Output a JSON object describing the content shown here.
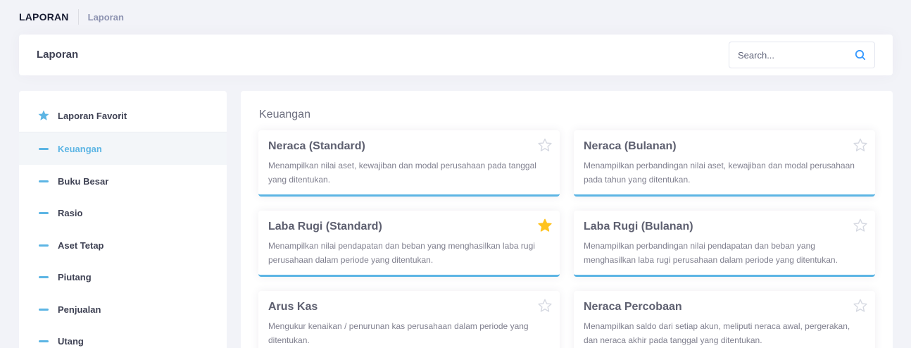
{
  "subheader": {
    "title": "LAPORAN",
    "breadcrumb": "Laporan"
  },
  "topbar": {
    "heading": "Laporan",
    "search_placeholder": "Search..."
  },
  "sidebar": {
    "favorite_label": "Laporan Favorit",
    "items": [
      {
        "label": "Keuangan",
        "active": true
      },
      {
        "label": "Buku Besar"
      },
      {
        "label": "Rasio"
      },
      {
        "label": "Aset Tetap"
      },
      {
        "label": "Piutang"
      },
      {
        "label": "Penjualan"
      },
      {
        "label": "Utang"
      }
    ]
  },
  "main": {
    "section_title": "Keuangan",
    "cards": [
      {
        "title": "Neraca (Standard)",
        "desc": "Menampilkan nilai aset, kewajiban dan modal perusahaan pada tanggal yang ditentukan.",
        "favorite": false
      },
      {
        "title": "Neraca (Bulanan)",
        "desc": "Menampilkan perbandingan nilai aset, kewajiban dan modal perusahaan pada tahun yang ditentukan.",
        "favorite": false
      },
      {
        "title": "Laba Rugi (Standard)",
        "desc": "Menampilkan nilai pendapatan dan beban yang menghasilkan laba rugi perusahaan dalam periode yang ditentukan.",
        "favorite": true
      },
      {
        "title": "Laba Rugi (Bulanan)",
        "desc": "Menampilkan perbandingan nilai pendapatan dan beban yang menghasilkan laba rugi perusahaan dalam periode yang ditentukan.",
        "favorite": false
      },
      {
        "title": "Arus Kas",
        "desc": "Mengukur kenaikan / penurunan kas perusahaan dalam periode yang ditentukan.",
        "favorite": false
      },
      {
        "title": "Neraca Percobaan",
        "desc": "Menampilkan saldo dari setiap akun, meliputi neraca awal, pergerakan, dan neraca akhir pada tanggal yang ditentukan.",
        "favorite": false
      }
    ]
  },
  "colors": {
    "accent": "#5cb5e4",
    "star_active": "#ffc31f",
    "star_inactive": "#d5d8e1"
  },
  "icons": {
    "search": "search-icon",
    "favorite": "star-icon",
    "sidebar_item": "dash-icon"
  }
}
